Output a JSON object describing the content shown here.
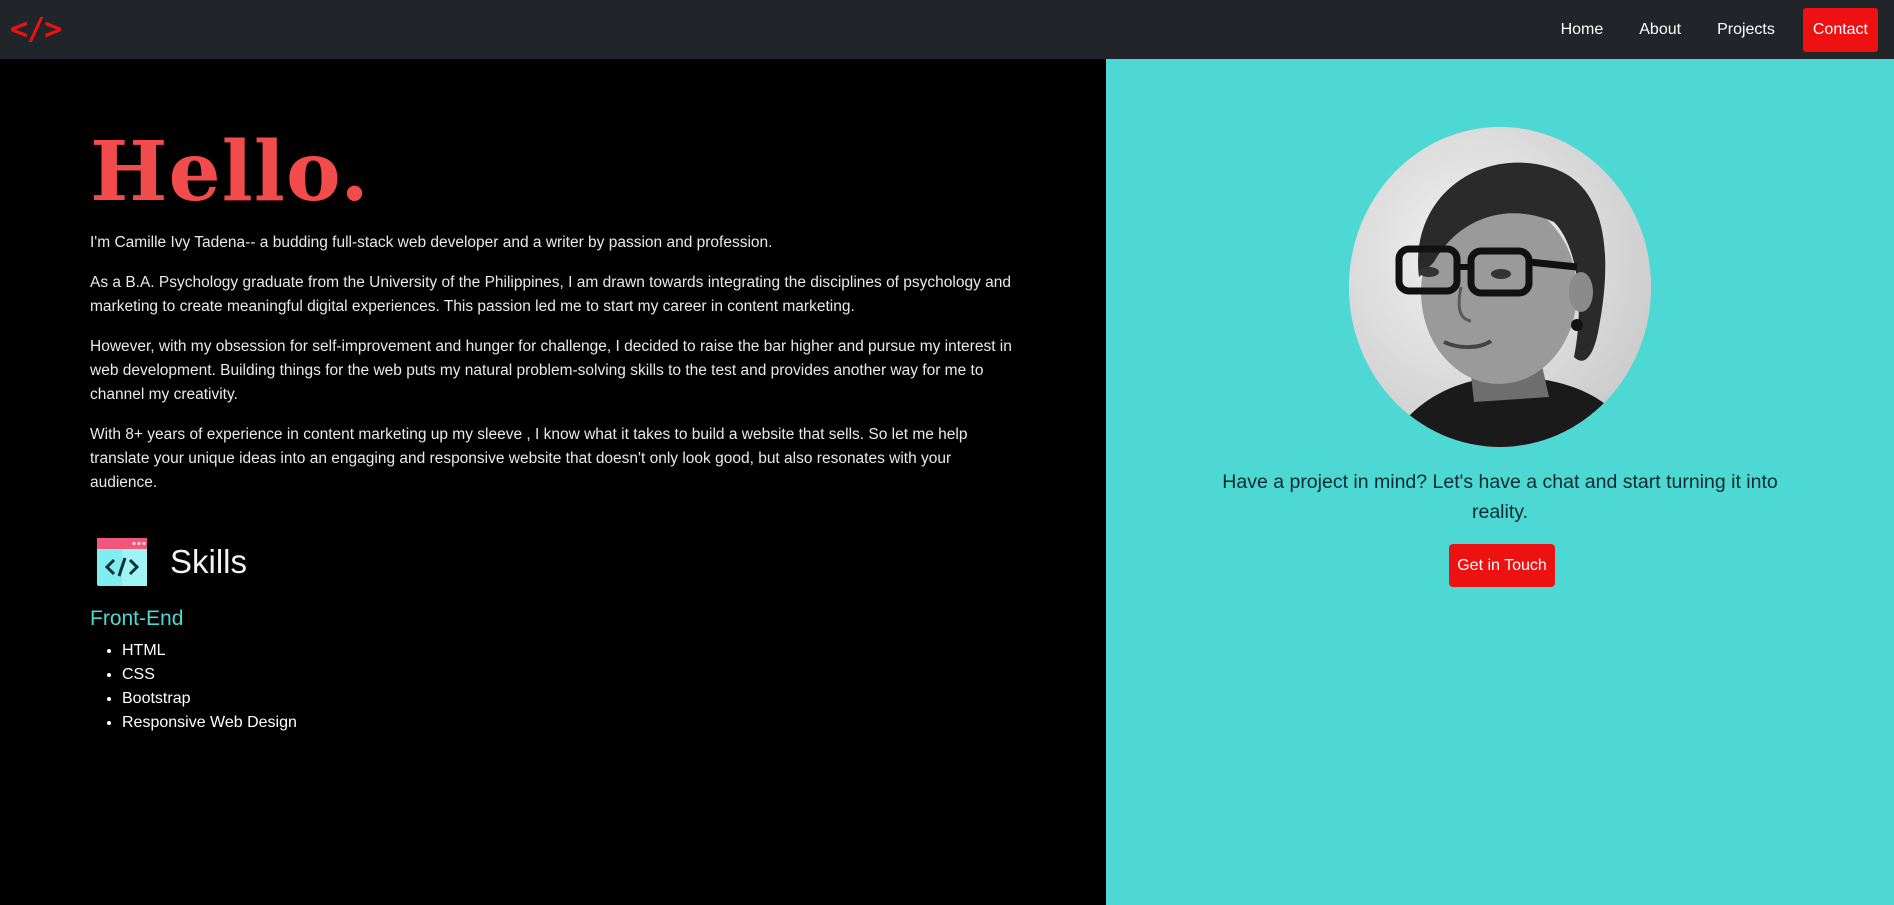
{
  "nav": {
    "logo_text": "</>",
    "links": [
      "Home",
      "About",
      "Projects"
    ],
    "contact_label": "Contact"
  },
  "hero": {
    "heading": "Hello.",
    "paragraphs": [
      "I'm Camille Ivy Tadena-- a budding full-stack web developer and a writer by passion and profession.",
      "As a B.A. Psychology graduate from the University of the Philippines, I am drawn towards integrating the disciplines of psychology and marketing to create meaningful digital experiences. This passion led me to start my career in content marketing.",
      "However, with my obsession for self-improvement and hunger for challenge, I decided to raise the bar higher and pursue my interest in web development. Building things for the web puts my natural problem-solving skills to the test and provides another way for me to channel my creativity.",
      "With 8+ years of experience in content marketing up my sleeve , I know what it takes to build a website that sells. So let me help translate your unique ideas into an engaging and responsive website that doesn't only look good, but also resonates with your audience."
    ]
  },
  "skills": {
    "title": "Skills",
    "icon": "code-window-icon",
    "frontend_title": "Front-End",
    "frontend_items": [
      "HTML",
      "CSS",
      "Bootstrap",
      "Responsive Web Design"
    ]
  },
  "sidebar": {
    "avatar": "profile-photo",
    "cta_text": "Have a project in mind? Let's have a chat and start turning it into reality.",
    "button_label": "Get in Touch"
  },
  "colors": {
    "navbar": "#212529",
    "accent_red": "#ee1111",
    "heading_red": "#f24b4b",
    "teal": "#4dd8d3",
    "left_bg": "#000000"
  }
}
